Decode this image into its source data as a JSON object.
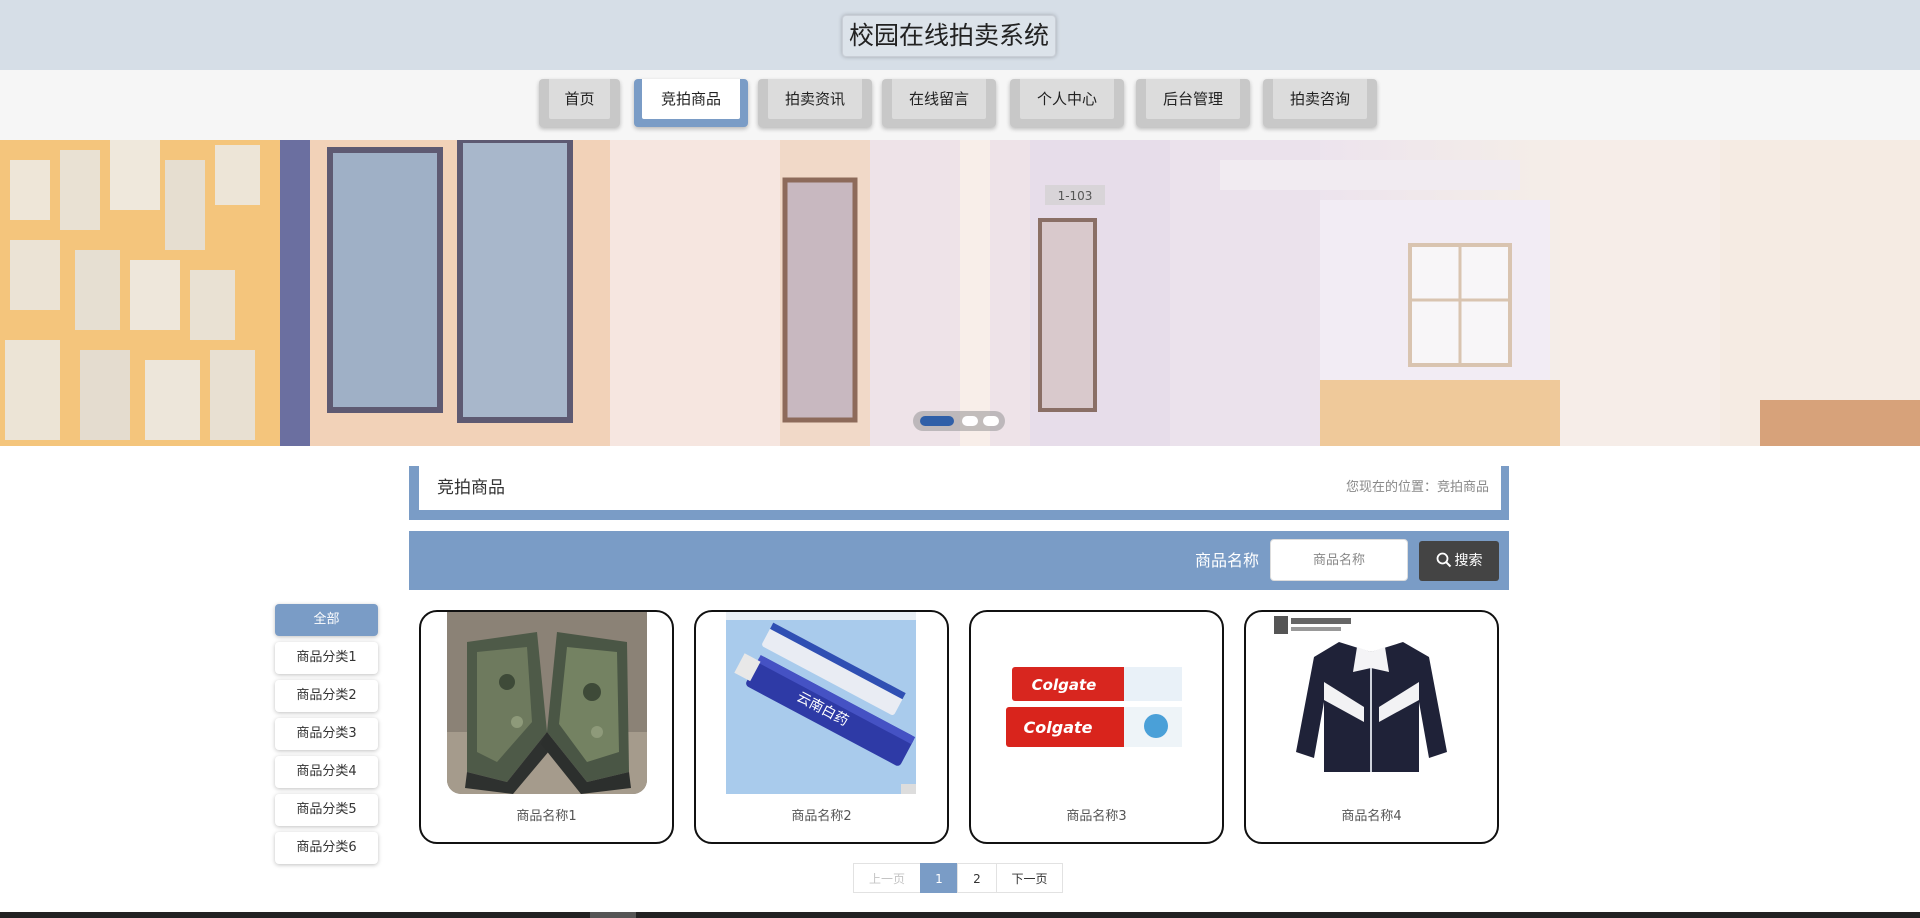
{
  "header": {
    "title": "校园在线拍卖系统"
  },
  "nav": {
    "items": [
      {
        "label": "首页"
      },
      {
        "label": "竞拍商品"
      },
      {
        "label": "拍卖资讯"
      },
      {
        "label": "在线留言"
      },
      {
        "label": "个人中心"
      },
      {
        "label": "后台管理"
      },
      {
        "label": "拍卖咨询"
      }
    ],
    "active": "竞拍商品"
  },
  "banner": {
    "door_sign": "1-103",
    "slides_count": 3,
    "active_slide": 1
  },
  "location": {
    "title": "竞拍商品",
    "breadcrumb": "您现在的位置：竞拍商品"
  },
  "search": {
    "label": "商品名称",
    "placeholder": "商品名称",
    "button_label": "搜索"
  },
  "categories": [
    {
      "label": "全部"
    },
    {
      "label": "商品分类1"
    },
    {
      "label": "商品分类2"
    },
    {
      "label": "商品分类3"
    },
    {
      "label": "商品分类4"
    },
    {
      "label": "商品分类5"
    },
    {
      "label": "商品分类6"
    }
  ],
  "products": [
    {
      "name": "商品名称1",
      "image": "camouflage-shoes"
    },
    {
      "name": "商品名称2",
      "image": "toothpaste-tube"
    },
    {
      "name": "商品名称3",
      "image": "colgate-toothpaste",
      "brand_text": "Colgate"
    },
    {
      "name": "商品名称4",
      "image": "track-jacket"
    }
  ],
  "pagination": {
    "prev_label": "上一页",
    "pages": [
      "1",
      "2"
    ],
    "current": "1",
    "next_label": "下一页"
  },
  "colors": {
    "accent": "#7a9cc6",
    "header_bg": "#d6dee7",
    "search_button": "#444444",
    "active_dot": "#2f5fa8"
  }
}
